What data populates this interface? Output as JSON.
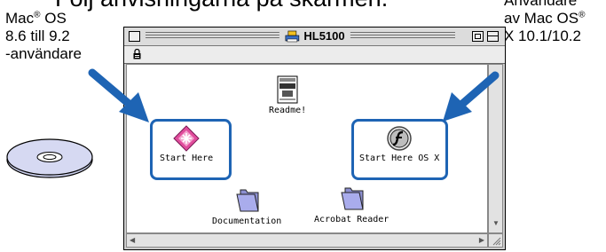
{
  "heading": {
    "text": "Följ anvisningarna på skärmen."
  },
  "annotations": {
    "left": {
      "line1": "Mac",
      "sup1": "®",
      "line1b": " OS",
      "line2": "8.6 till 9.2",
      "line3": "-användare"
    },
    "right": {
      "line1": "Användare",
      "line2": "av Mac OS",
      "sup2": "®",
      "line3": "X 10.1/10.2"
    }
  },
  "window": {
    "title": "HL5100",
    "icons": [
      {
        "label": "Readme!",
        "icon": "readme-document-icon"
      },
      {
        "label": "Start Here",
        "icon": "start-here-installer-icon"
      },
      {
        "label": "Start Here OS X",
        "icon": "flash-installer-icon"
      },
      {
        "label": "Documentation",
        "icon": "folder-icon"
      },
      {
        "label": "Acrobat Reader",
        "icon": "folder-icon"
      }
    ]
  },
  "colors": {
    "highlight": "#1e64b4",
    "window_bg": "#cccccc",
    "content_bg": "#ffffff"
  }
}
